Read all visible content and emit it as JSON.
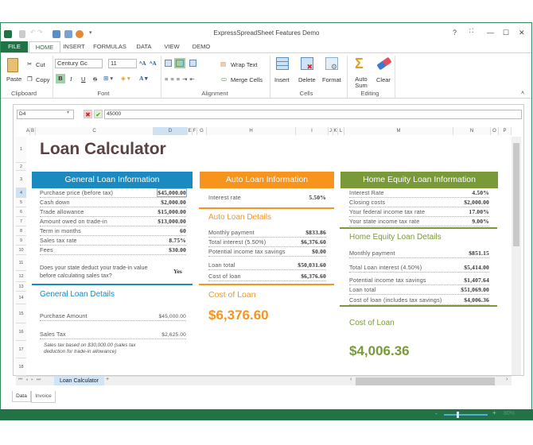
{
  "window": {
    "title": "ExpressSpreadSheet Features Demo",
    "help": "?",
    "restore": "⛶",
    "minimize": "—",
    "maximize": "☐",
    "close": "✕"
  },
  "tabs": [
    "FILE",
    "HOME",
    "INSERT",
    "FORMULAS",
    "DATA",
    "VIEW",
    "DEMO"
  ],
  "ribbon": {
    "paste": "Paste",
    "cut": "Cut",
    "copy": "Copy",
    "clipboard": "Clipboard",
    "font_name": "Century Gc",
    "font_size": "11",
    "bold": "B",
    "italic": "I",
    "underline": "U",
    "strike": "S",
    "font": "Font",
    "wrap_text": "Wrap Text",
    "merge_cells": "Merge Cells",
    "alignment": "Alignment",
    "insert": "Insert",
    "delete": "Delete",
    "format": "Format",
    "cells": "Cells",
    "auto_sum": "Auto Sum",
    "clear": "Clear",
    "editing": "Editing"
  },
  "formula_bar": {
    "cell_ref": "D4",
    "value": "45000"
  },
  "columns": [
    "A",
    "B",
    "C",
    "D",
    "E",
    "F",
    "G",
    "H",
    "I",
    "J",
    "K",
    "L",
    "M",
    "N",
    "O",
    "P"
  ],
  "rows": [
    "1",
    "2",
    "3",
    "4",
    "5",
    "6",
    "7",
    "8",
    "9",
    "10",
    "11",
    "12",
    "13",
    "14",
    "15",
    "16",
    "17",
    "18"
  ],
  "sheet": {
    "title": "Loan Calculator",
    "general": {
      "header": "General Loan Information",
      "items": [
        [
          "Purchase price (before tax)",
          "$45,000.00"
        ],
        [
          "Cash down",
          "$2,000.00"
        ],
        [
          "Trade allowance",
          "$15,000.00"
        ],
        [
          "Amount owed on trade-in",
          "$13,000.00"
        ],
        [
          "Term in months",
          "60"
        ],
        [
          "Sales tax rate",
          "8.75%"
        ],
        [
          "Fees",
          "$30.00"
        ]
      ],
      "question": "Does your state deduct your trade-in value before calculating sales tax?",
      "answer": "Yes",
      "details_title": "General Loan Details",
      "purchase_label": "Purchase Amount",
      "purchase_value": "$45,000.00",
      "tax_label": "Sales Tax",
      "tax_value": "$2,625.00",
      "note": "Sales tax based on $30,000.00 (sales tax deduction for trade-in allowance)"
    },
    "auto": {
      "header": "Auto Loan Information",
      "rate_label": "Interest rate",
      "rate_value": "5.50%",
      "details_title": "Auto Loan Details",
      "items": [
        [
          "Monthly payment",
          "$833.86"
        ],
        [
          "Total interest (5.50%)",
          "$6,376.60"
        ],
        [
          "Potential income tax savings",
          "$0.00"
        ],
        [
          "Loan total",
          "$50,031.60"
        ],
        [
          "Cost of loan",
          "$6,376.60"
        ]
      ],
      "cost_title": "Cost of Loan",
      "cost_value": "$6,376.60"
    },
    "home": {
      "header": "Home Equity Loan Information",
      "items": [
        [
          "Interest Rate",
          "4.50%"
        ],
        [
          "Closing costs",
          "$2,000.00"
        ],
        [
          "Your federal income tax rate",
          "17.00%"
        ],
        [
          "Your state income tax rate",
          "9.00%"
        ]
      ],
      "details_title": "Home Equity Loan Details",
      "details": [
        [
          "Monthly payment",
          "$851.15"
        ],
        [
          "Total Loan interest (4.50%)",
          "$5,414.00"
        ],
        [
          "Potential income tax savings",
          "$1,407.64"
        ],
        [
          "Loan total",
          "$51,069.00"
        ],
        [
          "Cost of loan (includes tax savings)",
          "$4,006.36"
        ]
      ],
      "cost_title": "Cost of Loan",
      "cost_value": "$4,006.36"
    }
  },
  "sheet_tab": "Loan Calculator",
  "doc_tabs": [
    "Data",
    "Invoice"
  ],
  "status": {
    "zoom": "80%"
  },
  "colors": {
    "blue": "#1a8ac0",
    "orange": "#f7941d",
    "green": "#7a9a3a",
    "excel": "#217346",
    "title": "#5a4242"
  }
}
